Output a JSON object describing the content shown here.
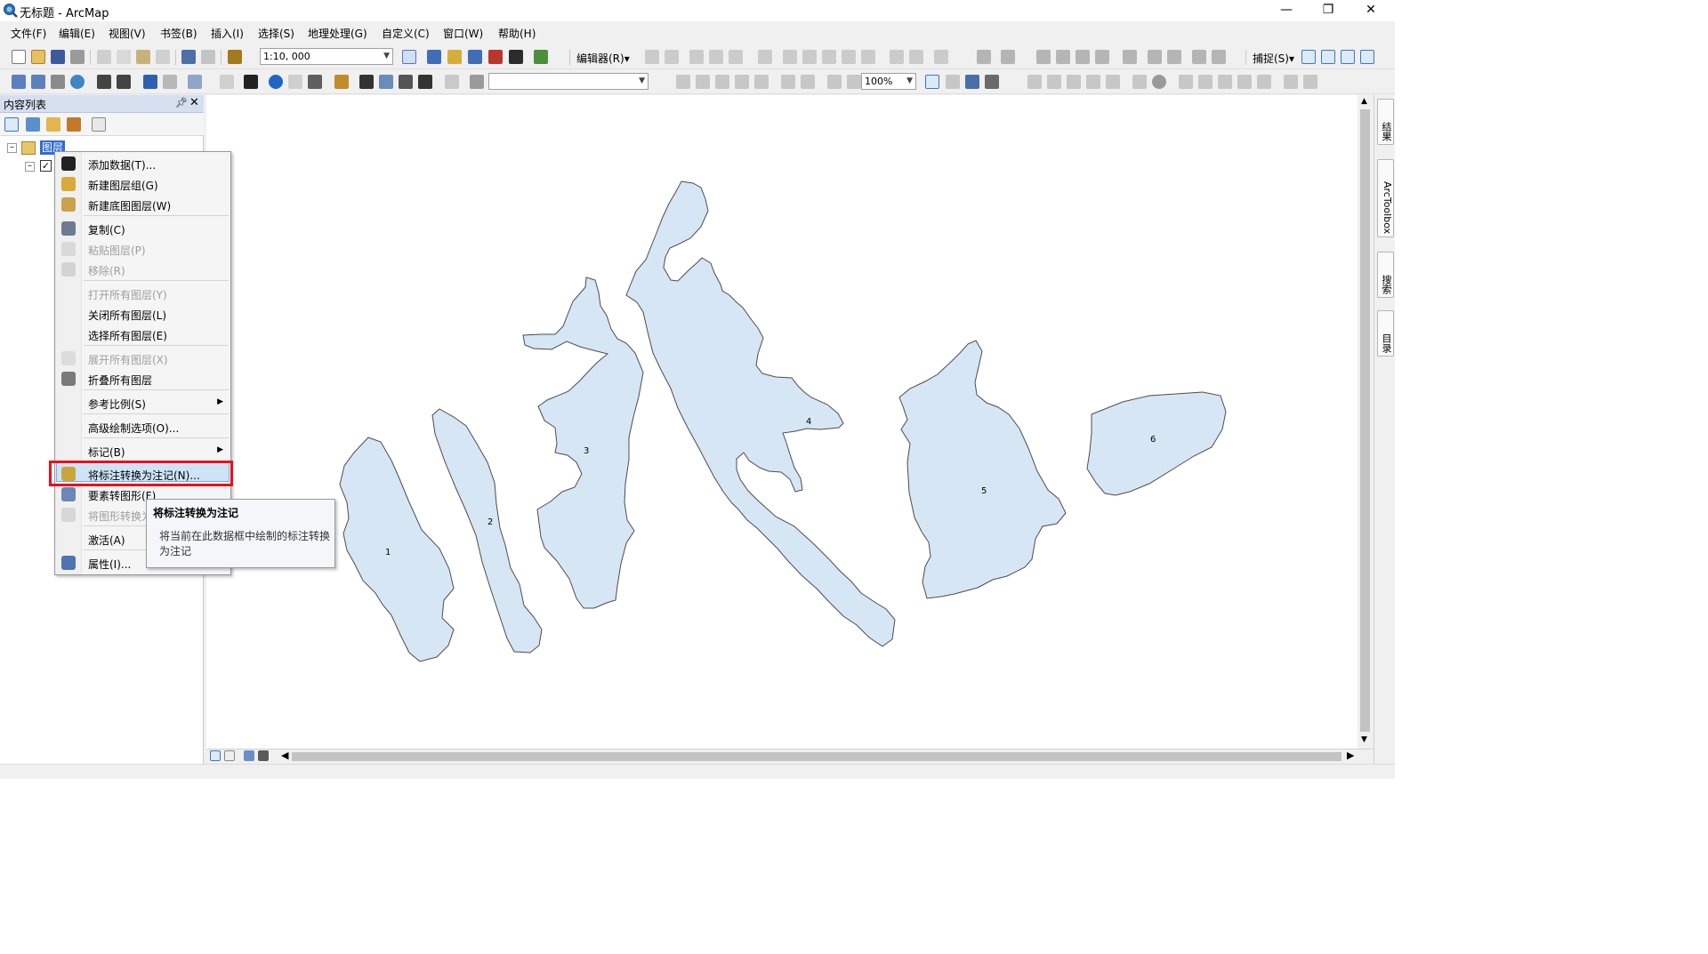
{
  "window": {
    "title": "无标题 - ArcMap",
    "controls": [
      "minimize-icon",
      "restore-icon",
      "close-icon"
    ]
  },
  "menubar": {
    "items": [
      "文件(F)",
      "编辑(E)",
      "视图(V)",
      "书签(B)",
      "插入(I)",
      "选择(S)",
      "地理处理(G)",
      "自定义(C)",
      "窗口(W)",
      "帮助(H)"
    ]
  },
  "toolbar1": {
    "scale": "1:10, 000",
    "editor_label": "编辑器(R)▾",
    "snapping_label": "捕捉(S)▾"
  },
  "toolbar2": {
    "zoom_percent": "100%"
  },
  "toc": {
    "title": "内容列表",
    "root_layer": "图层"
  },
  "context_menu": {
    "items": [
      {
        "label": "添加数据(T)...",
        "icon": "add-data-icon",
        "disabled": false
      },
      {
        "label": "新建图层组(G)",
        "icon": "new-group-layer-icon",
        "disabled": false
      },
      {
        "label": "新建底图图层(W)",
        "icon": "new-basemap-layer-icon",
        "disabled": false
      },
      {
        "label": "复制(C)",
        "icon": "copy-icon",
        "disabled": false
      },
      {
        "label": "粘贴图层(P)",
        "icon": "paste-icon",
        "disabled": true
      },
      {
        "label": "移除(R)",
        "icon": "remove-icon",
        "disabled": true
      },
      {
        "label": "打开所有图层(Y)",
        "icon": "",
        "disabled": true
      },
      {
        "label": "关闭所有图层(L)",
        "icon": "",
        "disabled": false
      },
      {
        "label": "选择所有图层(E)",
        "icon": "",
        "disabled": false
      },
      {
        "label": "展开所有图层(X)",
        "icon": "expand-icon",
        "disabled": true
      },
      {
        "label": "折叠所有图层",
        "icon": "collapse-icon",
        "disabled": false
      },
      {
        "label": "参考比例(S)",
        "icon": "",
        "disabled": false,
        "submenu": true
      },
      {
        "label": "高级绘制选项(O)...",
        "icon": "",
        "disabled": false
      },
      {
        "label": "标记(B)",
        "icon": "",
        "disabled": false,
        "submenu": true
      },
      {
        "label": "将标注转换为注记(N)...",
        "icon": "convert-labels-icon",
        "disabled": false,
        "highlighted": true
      },
      {
        "label": "要素转图形(F)",
        "icon": "features-to-graphics-icon",
        "disabled": false
      },
      {
        "label": "将图形转换为要素",
        "icon": "graphics-to-features-icon",
        "disabled": true
      },
      {
        "label": "激活(A)",
        "icon": "",
        "disabled": false
      },
      {
        "label": "属性(I)...",
        "icon": "properties-icon",
        "disabled": false
      }
    ]
  },
  "tooltip": {
    "title": "将标注转换为注记",
    "body": "将当前在此数据框中绘制的标注转换为注记"
  },
  "right_panel": {
    "tabs": [
      "结果",
      "ArcToolbox",
      "搜索",
      "目录"
    ]
  },
  "map": {
    "fill_color": "#d6e6f4",
    "stroke_color": "#4d4d4d",
    "polygon_labels": [
      "1",
      "2",
      "3",
      "4",
      "5",
      "6"
    ]
  }
}
